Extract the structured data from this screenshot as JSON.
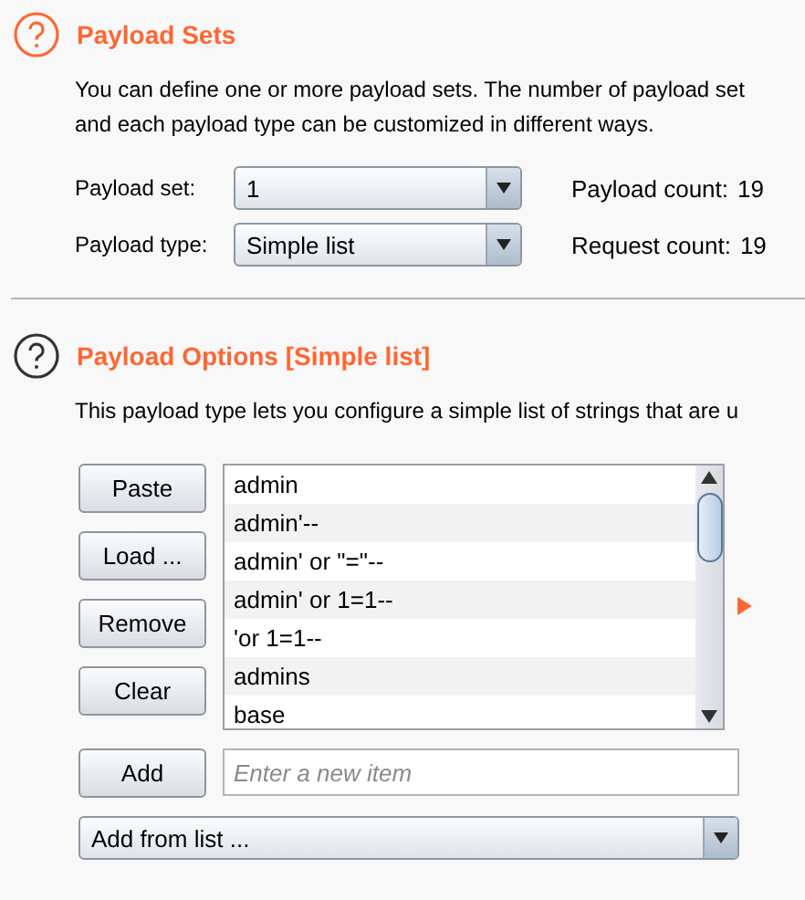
{
  "payload_sets": {
    "title": "Payload Sets",
    "description": [
      "You can define one or more payload sets. The number of payload set",
      "and each payload type can be customized in different ways."
    ],
    "fields": [
      {
        "label": "Payload set:",
        "value": "1",
        "info_label": "Payload count:",
        "info_value": "19"
      },
      {
        "label": "Payload type:",
        "value": "Simple list",
        "info_label": "Request count:",
        "info_value": "19"
      }
    ]
  },
  "payload_options": {
    "title": "Payload Options [Simple list]",
    "description": "This payload type lets you configure a simple list of strings that are u",
    "buttons": [
      "Paste",
      "Load ...",
      "Remove",
      "Clear"
    ],
    "items": [
      "admin",
      "admin'--",
      "admin' or \"=\"--",
      "admin' or 1=1--",
      "'or 1=1--",
      "admins",
      "base"
    ],
    "add_button": "Add",
    "add_field": {
      "placeholder": "Enter a new item"
    },
    "add_from_list": "Add from list ..."
  }
}
